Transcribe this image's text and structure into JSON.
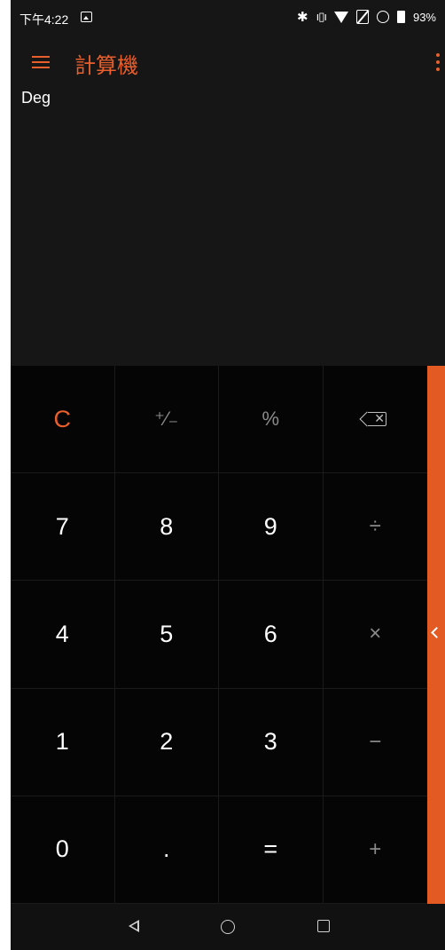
{
  "status_bar": {
    "time": "下午4:22",
    "battery_percent": "93%",
    "icons": [
      "gallery-icon",
      "bluetooth-icon",
      "vibrate-icon",
      "wifi-icon",
      "no-sim-icon",
      "alarm-icon",
      "battery-icon"
    ]
  },
  "app_bar": {
    "title": "計算機"
  },
  "display": {
    "angle_mode": "Deg"
  },
  "keypad": {
    "rows": [
      [
        "C",
        "+⁄₋",
        "%",
        "backspace"
      ],
      [
        "7",
        "8",
        "9",
        "÷"
      ],
      [
        "4",
        "5",
        "6",
        "×"
      ],
      [
        "1",
        "2",
        "3",
        "−"
      ],
      [
        "0",
        ".",
        "=",
        "+"
      ]
    ],
    "clear": "C",
    "plus_minus": "⁺⁄₋",
    "percent": "%",
    "seven": "7",
    "eight": "8",
    "nine": "9",
    "divide": "÷",
    "four": "4",
    "five": "5",
    "six": "6",
    "multiply": "×",
    "one": "1",
    "two": "2",
    "three": "3",
    "minus": "−",
    "zero": "0",
    "decimal": ".",
    "equals": "=",
    "plus": "+"
  },
  "colors": {
    "accent": "#e85f2c",
    "side_panel": "#e35a22",
    "display_bg": "#161616",
    "keypad_bg": "#050505"
  }
}
